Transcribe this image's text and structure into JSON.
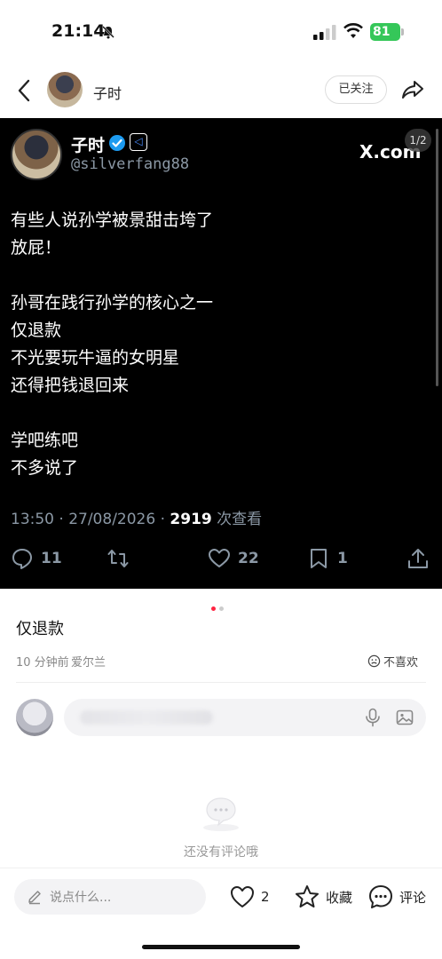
{
  "status_bar": {
    "time": "21:14",
    "battery": "81",
    "icons": [
      "bell-muted-icon",
      "signal-icon",
      "wifi-icon",
      "battery-icon"
    ]
  },
  "header": {
    "username": "子时",
    "follow_label": "已关注",
    "icons": [
      "back-icon",
      "share-icon"
    ]
  },
  "post_image": {
    "author_name": "子时",
    "author_handle": "@silverfang88",
    "watermark": "X.com",
    "pager": "1/2",
    "lines": [
      "有些人说孙学被景甜击垮了",
      "放屁！",
      "",
      "孙哥在践行孙学的核心之一",
      "仅退款",
      "不光要玩牛逼的女明星",
      "还得把钱退回来",
      "",
      "学吧练吧",
      "不多说了"
    ],
    "meta_time": "13:50 · 27/08/2026 · ",
    "views": "2919",
    "views_label": " 次查看",
    "actions": {
      "replies": "11",
      "likes": "22",
      "bookmarks": "1"
    }
  },
  "post": {
    "title": "仅退款",
    "time_ago": "10 分钟前",
    "location": "爱尔兰",
    "dislike_label": "不喜欢"
  },
  "comments": {
    "empty_text": "还没有评论哦"
  },
  "bottom_bar": {
    "say_placeholder": "说点什么...",
    "likes": "2",
    "favorite_label": "收藏",
    "comment_label": "评论"
  },
  "colors": {
    "accent_dot": "#ff2442",
    "verified_blue": "#1d9bf0",
    "battery_green": "#35c759"
  }
}
